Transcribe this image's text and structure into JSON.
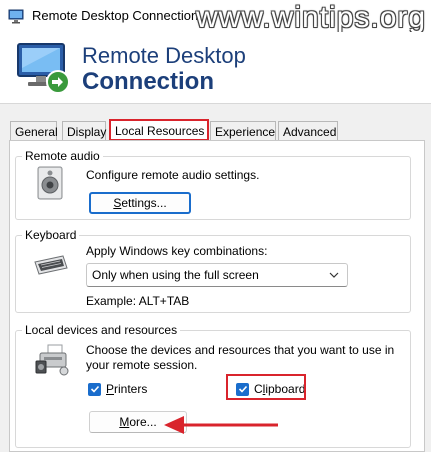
{
  "window": {
    "title": "Remote Desktop Connection",
    "watermark": "www.wintips.org"
  },
  "banner": {
    "line1": "Remote Desktop",
    "line2": "Connection"
  },
  "tabs": [
    {
      "label": "General",
      "active": false
    },
    {
      "label": "Display",
      "active": false
    },
    {
      "label": "Local Resources",
      "active": true
    },
    {
      "label": "Experience",
      "active": false
    },
    {
      "label": "Advanced",
      "active": false
    }
  ],
  "remote_audio": {
    "group_label": "Remote audio",
    "description": "Configure remote audio settings.",
    "settings_button": {
      "prefix": "",
      "accel": "S",
      "rest": "ettings..."
    }
  },
  "keyboard": {
    "group_label": "Keyboard",
    "description": "Apply Windows key combinations:",
    "selected_option": "Only when using the full screen",
    "example": "Example: ALT+TAB"
  },
  "local_devices": {
    "group_label": "Local devices and resources",
    "description_line1": "Choose the devices and resources that you want to use in",
    "description_line2": "your remote session.",
    "printers": {
      "prefix": "",
      "accel": "P",
      "rest": "rinters",
      "checked": true
    },
    "clipboard": {
      "prefix": "C",
      "accel": "l",
      "rest": "ipboard",
      "checked": true
    },
    "more_button": {
      "prefix": "",
      "accel": "M",
      "rest": "ore..."
    }
  },
  "colors": {
    "highlight_red": "#d9242c",
    "accent_blue": "#1a6dcc",
    "banner_text": "#1c3f7a"
  },
  "icons": {
    "app": "remote-desktop-icon",
    "audio": "speaker-icon",
    "keyboard": "keyboard-icon",
    "devices": "devices-icon"
  }
}
